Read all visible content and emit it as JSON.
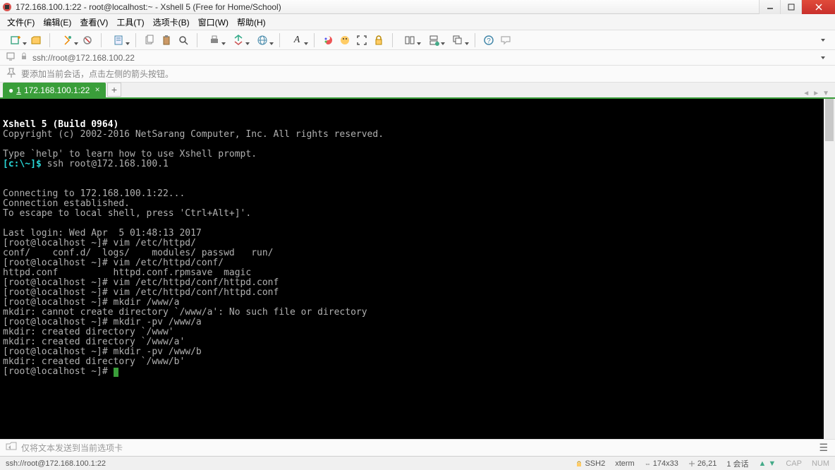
{
  "window": {
    "title": "172.168.100.1:22 - root@localhost:~ - Xshell 5 (Free for Home/School)"
  },
  "menubar": [
    "文件(F)",
    "编辑(E)",
    "查看(V)",
    "工具(T)",
    "选项卡(B)",
    "窗口(W)",
    "帮助(H)"
  ],
  "address": "ssh://root@172.168.100.22",
  "info_hint": "要添加当前会话，点击左侧的箭头按钮。",
  "tab": {
    "num": "1",
    "label": "172.168.100.1:22"
  },
  "terminal_lines": [
    {
      "t": "Xshell 5 (Build 0964)",
      "c": "bold"
    },
    {
      "t": "Copyright (c) 2002-2016 NetSarang Computer, Inc. All rights reserved."
    },
    {
      "t": ""
    },
    {
      "t": "Type `help' to learn how to use Xshell prompt."
    },
    {
      "seg": [
        {
          "t": "[c:\\~]$ ",
          "c": "cyan"
        },
        {
          "t": "ssh root@172.168.100.1"
        }
      ]
    },
    {
      "t": ""
    },
    {
      "t": ""
    },
    {
      "t": "Connecting to 172.168.100.1:22..."
    },
    {
      "t": "Connection established."
    },
    {
      "t": "To escape to local shell, press 'Ctrl+Alt+]'."
    },
    {
      "t": ""
    },
    {
      "t": "Last login: Wed Apr  5 01:48:13 2017"
    },
    {
      "t": "[root@localhost ~]# vim /etc/httpd/"
    },
    {
      "t": "conf/    conf.d/  logs/    modules/ passwd   run/"
    },
    {
      "t": "[root@localhost ~]# vim /etc/httpd/conf/"
    },
    {
      "t": "httpd.conf          httpd.conf.rpmsave  magic"
    },
    {
      "t": "[root@localhost ~]# vim /etc/httpd/conf/httpd.conf"
    },
    {
      "t": "[root@localhost ~]# vim /etc/httpd/conf/httpd.conf"
    },
    {
      "t": "[root@localhost ~]# mkdir /www/a"
    },
    {
      "t": "mkdir: cannot create directory `/www/a': No such file or directory"
    },
    {
      "t": "[root@localhost ~]# mkdir -pv /www/a"
    },
    {
      "t": "mkdir: created directory `/www'"
    },
    {
      "t": "mkdir: created directory `/www/a'"
    },
    {
      "t": "[root@localhost ~]# mkdir -pv /www/b"
    },
    {
      "t": "mkdir: created directory `/www/b'"
    },
    {
      "seg": [
        {
          "t": "[root@localhost ~]# "
        },
        {
          "cursor": true
        }
      ]
    }
  ],
  "sendbar_placeholder": "仅将文本发送到当前选项卡",
  "status": {
    "left": "ssh://root@172.168.100.1:22",
    "ssh": "SSH2",
    "term": "xterm",
    "size": "174x33",
    "pos": "26,21",
    "sessions": "1 会话",
    "cap": "CAP",
    "num": "NUM"
  }
}
